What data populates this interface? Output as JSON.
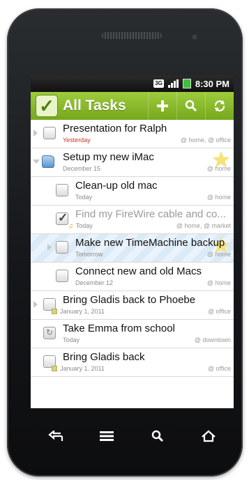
{
  "status": {
    "network": "3G",
    "time": "8:30 PM"
  },
  "app": {
    "title": "All Tasks"
  },
  "toolbar": {
    "icons": [
      "add-icon",
      "search-icon",
      "sync-icon"
    ]
  },
  "tasks": [
    {
      "title": "Presentation for Ralph",
      "due": "Yesterday",
      "contexts": "@ home, @ office",
      "overdue": true
    },
    {
      "title": "Setup my new iMac",
      "due": "December 15",
      "contexts": "@ home",
      "folder": true,
      "starred": true
    },
    {
      "title": "Clean-up old mac",
      "due": "Today",
      "contexts": "@ home"
    },
    {
      "title": "Find my FireWire cable and co...",
      "due": "Today",
      "contexts": "@ home, @ market",
      "done": true,
      "reminder": true
    },
    {
      "title": "Make new TimeMachine backup",
      "due": "Tomorrow",
      "contexts": "@ home",
      "starred": true,
      "highlight": true
    },
    {
      "title": "Connect new and old Macs",
      "due": "December 12",
      "contexts": "@ home"
    },
    {
      "title": "Bring Gladis back to Phoebe",
      "due": "January 1, 2011",
      "contexts": "@ office"
    },
    {
      "title": "Take Emma from school",
      "due": "Today",
      "contexts": "@ downtown",
      "repeating": true
    },
    {
      "title": "Bring Gladis back",
      "due": "January 1, 2011",
      "contexts": "@ office"
    }
  ],
  "navbar": {
    "icons": [
      "back-icon",
      "menu-icon",
      "search-icon",
      "home-icon"
    ]
  },
  "colors": {
    "accent": "#8bbd2c",
    "star": "#f6e27a"
  }
}
